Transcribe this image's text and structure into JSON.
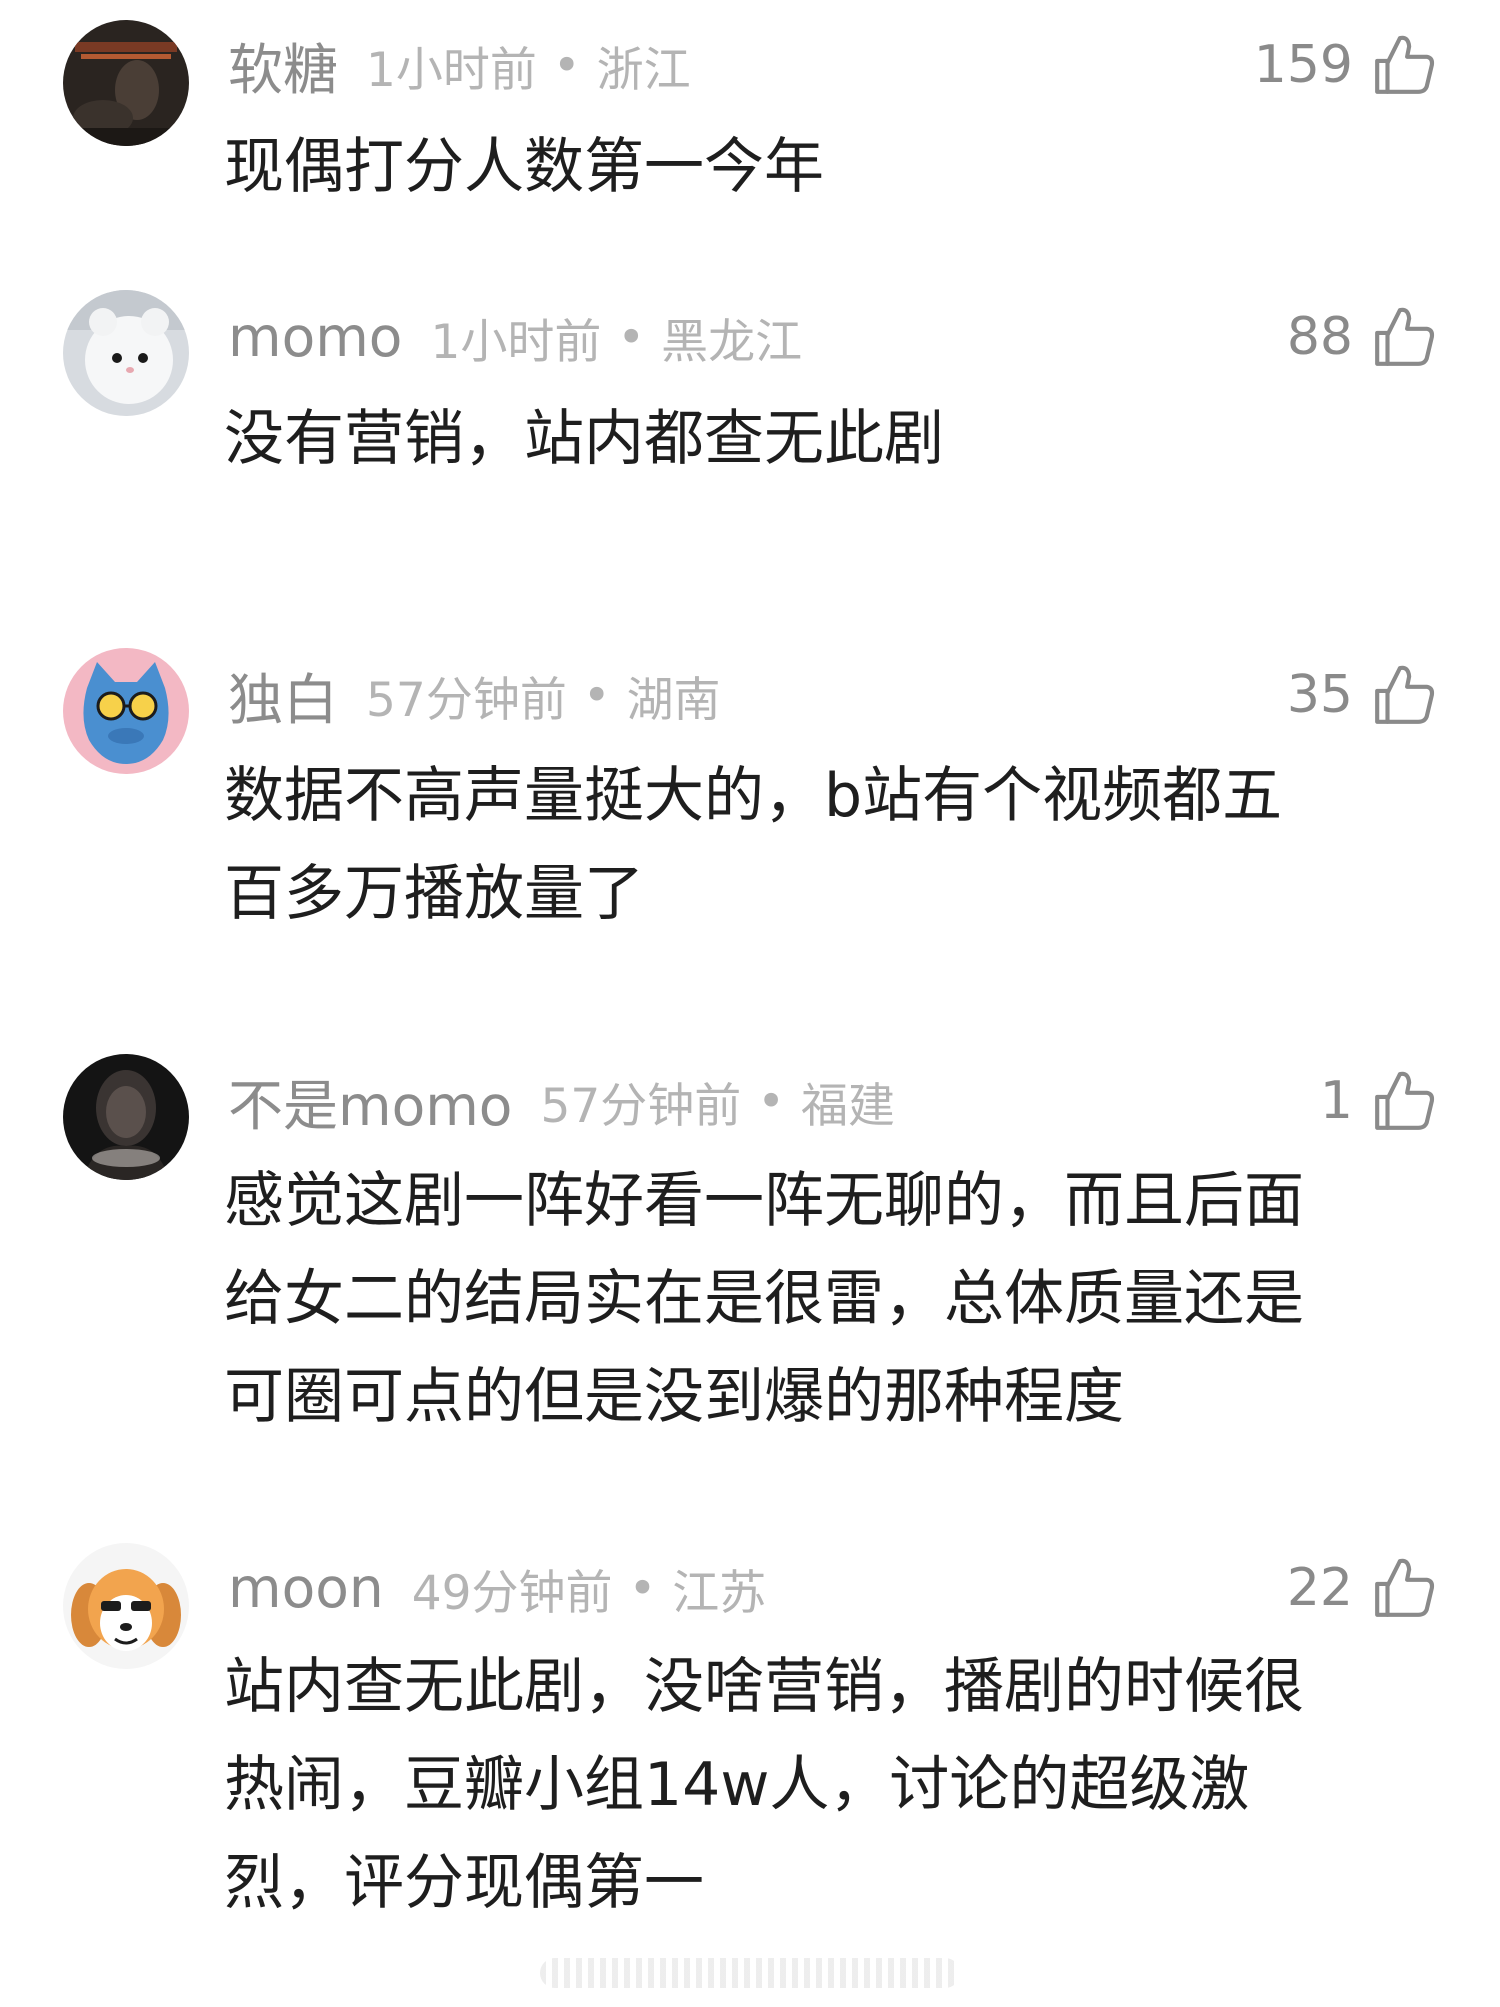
{
  "comments": [
    {
      "username": "软糖",
      "time": "1小时前",
      "location": "浙江",
      "likes": "159",
      "content": "现偶打分人数第一今年",
      "avatar_icon": "avatar-dark-room-icon",
      "avatar_color": "#2a2420"
    },
    {
      "username": "momo",
      "time": "1小时前",
      "location": "黑龙江",
      "likes": "88",
      "content": "没有营销，站内都查无此剧",
      "avatar_icon": "avatar-white-plush-icon",
      "avatar_color": "#e8eaec"
    },
    {
      "username": "独白",
      "time": "57分钟前",
      "location": "湖南",
      "likes": "35",
      "content": "数据不高声量挺大的，b站有个视频都五\n百多万播放量了",
      "avatar_icon": "avatar-blue-cat-icon",
      "avatar_color": "#f3b8c4"
    },
    {
      "username": "不是momo",
      "time": "57分钟前",
      "location": "福建",
      "likes": "1",
      "content": "感觉这剧一阵好看一阵无聊的，而且后面\n给女二的结局实在是很雷，总体质量还是\n可圈可点的但是没到爆的那种程度",
      "avatar_icon": "avatar-dark-portrait-icon",
      "avatar_color": "#1a1a1a"
    },
    {
      "username": "moon",
      "time": "49分钟前",
      "location": "江苏",
      "likes": "22",
      "content": "站内查无此剧，没啥营销，播剧的时候很\n热闹，豆瓣小组14w人，讨论的超级激\n烈，评分现偶第一",
      "avatar_icon": "avatar-cartoon-dog-icon",
      "avatar_color": "#f5f5f5"
    }
  ],
  "separator": "•",
  "colors": {
    "username": "#8c8c8c",
    "meta": "#b4b4b4",
    "content": "#1e1e1e",
    "like_icon": "#8a8a8a"
  }
}
